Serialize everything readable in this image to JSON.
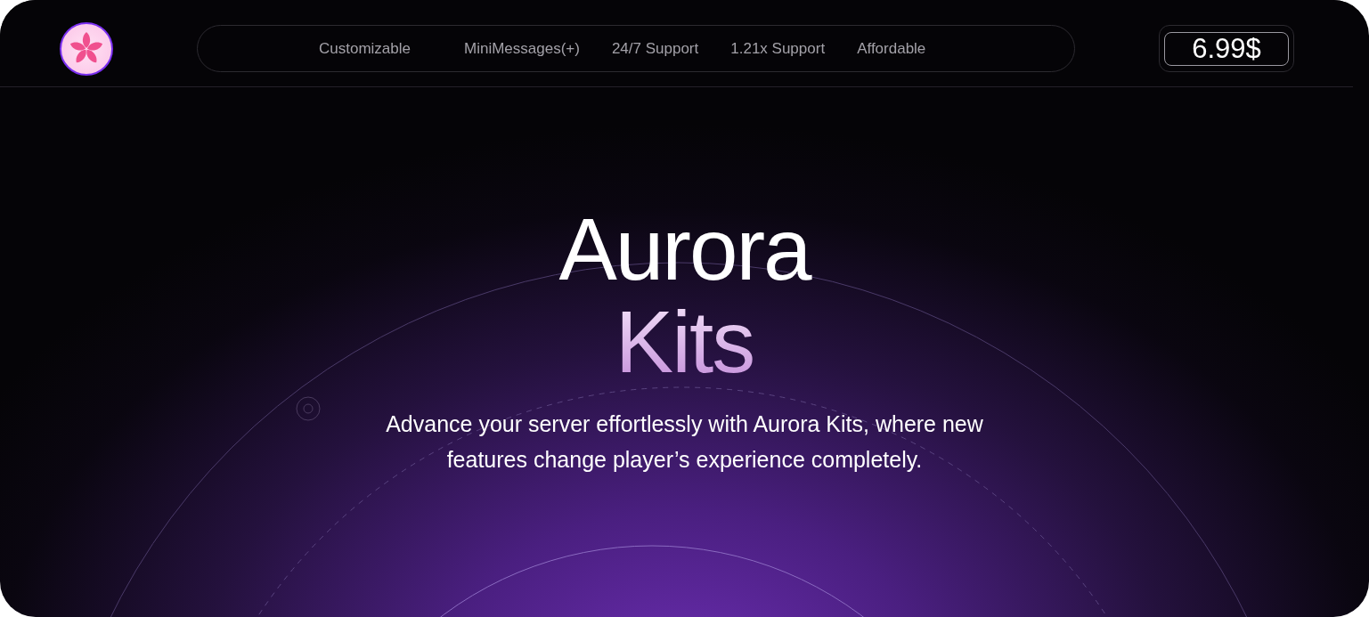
{
  "nav": {
    "items": [
      "Customizable",
      "MiniMessages(+)",
      "24/7 Support",
      "1.21x Support",
      "Affordable"
    ]
  },
  "price": "6.99$",
  "hero": {
    "title": "Aurora",
    "subtitle": "Kits",
    "description": "Advance your server effortlessly with Aurora Kits, where new features change player’s experience completely."
  }
}
